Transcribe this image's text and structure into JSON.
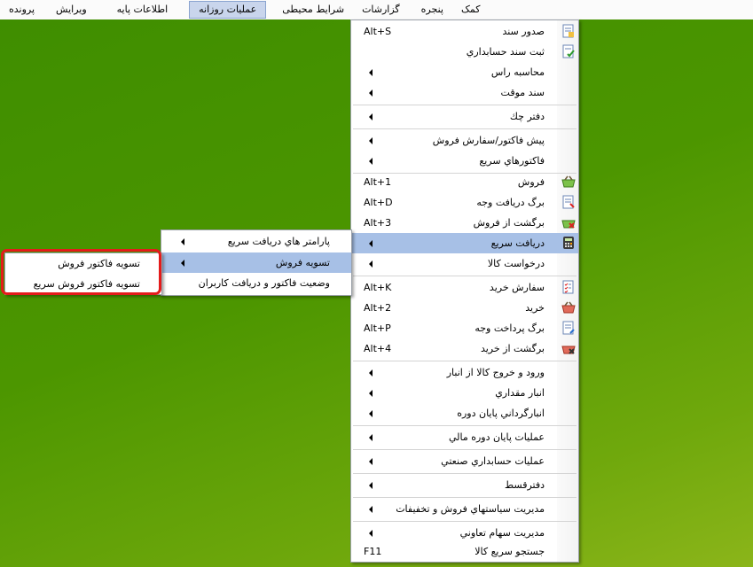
{
  "menubar": {
    "items": [
      {
        "label": "پرونده"
      },
      {
        "label": "ویرایش"
      },
      {
        "label": "اطلاعات پایه"
      },
      {
        "label": "عملیات روزانه",
        "active": true
      },
      {
        "label": "شرایط محیطی"
      },
      {
        "label": "گزارشات"
      },
      {
        "label": "پنجره"
      },
      {
        "label": "کمک"
      }
    ]
  },
  "main_menu": {
    "items": [
      {
        "label": "صدور سند",
        "shortcut": "Alt+S",
        "icon": "document-icon"
      },
      {
        "label": "ثبت سند حسابداري",
        "icon": "document-check-icon"
      },
      {
        "label": "محاسبه راس",
        "submenu": true
      },
      {
        "label": "سند موقت",
        "submenu": true
      },
      {
        "label": "دفتر چك",
        "submenu": true
      },
      {
        "label": "پيش فاكتور/سفارش فروش",
        "submenu": true
      },
      {
        "label": "فاكتورهاي سريع",
        "submenu": true
      },
      {
        "label": "فروش",
        "shortcut": "Alt+1",
        "icon": "basket-icon"
      },
      {
        "label": "برگ دريافت وجه",
        "shortcut": "Alt+D",
        "icon": "receipt-icon"
      },
      {
        "label": "برگشت از فروش",
        "shortcut": "Alt+3",
        "icon": "basket-return-icon"
      },
      {
        "label": "دريافت سريع",
        "submenu": true,
        "icon": "calculator-icon",
        "highlight": true
      },
      {
        "label": "درخواست كالا",
        "submenu": true
      },
      {
        "label": "سفارش خريد",
        "shortcut": "Alt+K",
        "icon": "checklist-icon"
      },
      {
        "label": "خريد",
        "shortcut": "Alt+2",
        "icon": "basket-red-icon"
      },
      {
        "label": "برگ پرداخت وجه",
        "shortcut": "Alt+P",
        "icon": "payment-icon"
      },
      {
        "label": "برگشت از خريد",
        "shortcut": "Alt+4",
        "icon": "basket-red-return-icon"
      },
      {
        "label": "ورود و خروج كالا از انبار",
        "submenu": true
      },
      {
        "label": "انبار مقداري",
        "submenu": true
      },
      {
        "label": "انبارگرداني پايان دوره",
        "submenu": true
      },
      {
        "label": "عمليات پايان دوره مالي",
        "submenu": true
      },
      {
        "label": "عمليات حسابداري صنعتي",
        "submenu": true
      },
      {
        "label": "دفترقسط",
        "submenu": true
      },
      {
        "label": "مديريت سياستهاي فروش و تخفيفات",
        "submenu": true
      },
      {
        "label": "مديريت سهام تعاوني",
        "submenu": true
      },
      {
        "label": "جستجو سريع كالا",
        "shortcut": "F11"
      }
    ]
  },
  "submenu_quick_receive": {
    "items": [
      {
        "label": "پارامتر هاي دريافت سريع",
        "submenu": true
      },
      {
        "label": "تسويه فروش",
        "submenu": true,
        "highlight": true
      },
      {
        "label": "وضعيت فاكتور و دريافت كاربران"
      }
    ]
  },
  "submenu_settlement": {
    "items": [
      {
        "label": "تسويه فاكتور فروش"
      },
      {
        "label": "تسويه فاكتور فروش سريع"
      }
    ]
  },
  "colors": {
    "desktop": "#4c9600",
    "highlight": "#a7c0e6",
    "callout": "#e41b1b"
  }
}
